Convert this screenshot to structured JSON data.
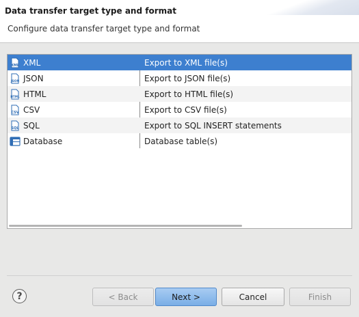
{
  "header": {
    "title": "Data transfer target type and format",
    "subtitle": "Configure data transfer target type and format"
  },
  "types": [
    {
      "name": "XML",
      "description": "Export to XML file(s)",
      "icon": "xml-file-icon",
      "selected": true
    },
    {
      "name": "JSON",
      "description": "Export to JSON file(s)",
      "icon": "json-file-icon",
      "selected": false
    },
    {
      "name": "HTML",
      "description": "Export to HTML file(s)",
      "icon": "html-file-icon",
      "selected": false
    },
    {
      "name": "CSV",
      "description": "Export to CSV file(s)",
      "icon": "csv-file-icon",
      "selected": false
    },
    {
      "name": "SQL",
      "description": "Export to SQL INSERT statements",
      "icon": "sql-file-icon",
      "selected": false
    },
    {
      "name": "Database",
      "description": "Database table(s)",
      "icon": "database-table-icon",
      "selected": false
    }
  ],
  "icon_labels": {
    "xml": "XML",
    "json": "JSON",
    "html": "HTML",
    "csv": "CSV",
    "sql": "SQL"
  },
  "footer": {
    "help_label": "?",
    "back_label": "< Back",
    "next_label": "Next >",
    "cancel_label": "Cancel",
    "finish_label": "Finish"
  },
  "colors": {
    "selection": "#3d7fcf",
    "primary_button": "#8fbdeb",
    "icon_blue": "#2f6db5"
  }
}
